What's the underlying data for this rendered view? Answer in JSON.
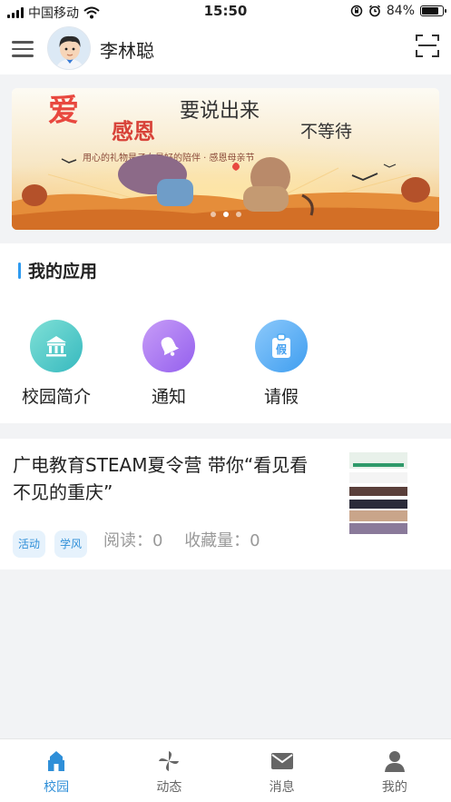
{
  "status_bar": {
    "carrier": "中国移动",
    "time": "15:50",
    "battery": "84%",
    "battery_level": 0.84
  },
  "header": {
    "user_name": "李林聪",
    "menu_icon": "menu-icon",
    "scan_icon": "scan-icon"
  },
  "banner": {
    "headline_top": "要说出来",
    "headline_mid": "不等待",
    "subline": "用心的礼物是子女最好的陪伴 · 感恩母亲节",
    "dot_count": 3,
    "active_dot": 2
  },
  "apps": {
    "title": "我的应用",
    "items": [
      {
        "label": "校园简介",
        "icon": "school-building-icon",
        "color": "#3ec7c0"
      },
      {
        "label": "通知",
        "icon": "bell-icon",
        "color": "#a36ef0"
      },
      {
        "label": "请假",
        "icon": "leave-tag-icon",
        "color": "#4aa9f2"
      }
    ]
  },
  "article": {
    "title": "广电教育STEAM夏令营 带你“看见看不见的重庆”",
    "tags": [
      "活动",
      "学风"
    ],
    "read_count": "阅读：0",
    "favorite_count": "收藏量：0"
  },
  "bottom_nav": {
    "items": [
      {
        "label": "校园",
        "icon": "campus-home-icon",
        "active": true
      },
      {
        "label": "动态",
        "icon": "pinwheel-icon",
        "active": false
      },
      {
        "label": "消息",
        "icon": "envelope-icon",
        "active": false
      },
      {
        "label": "我的",
        "icon": "person-icon",
        "active": false
      }
    ]
  },
  "colors": {
    "accent": "#2f8fd8",
    "section_bar": "#2f9bf0",
    "page_background": "#f2f3f5"
  }
}
